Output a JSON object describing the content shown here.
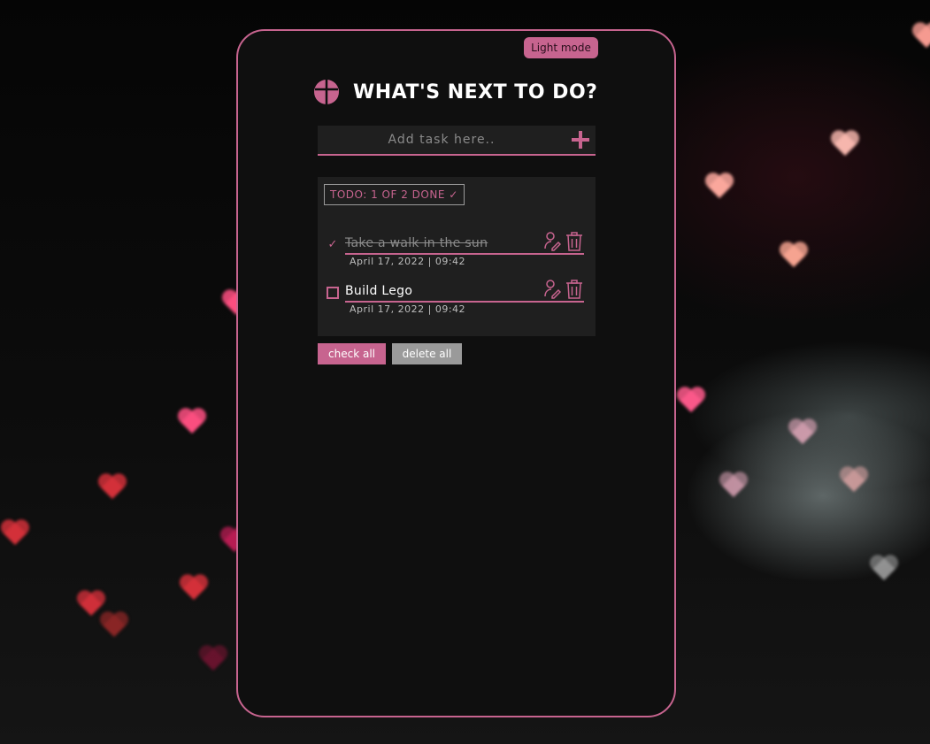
{
  "theme": {
    "accent": "#c7648f",
    "card_background": "#0f0f0f",
    "panel_background": "#1f1f1f",
    "muted_button": "#9a9a9a"
  },
  "header": {
    "mode_toggle_label": "Light mode",
    "title": "WHAT'S NEXT TO DO?"
  },
  "add_task": {
    "placeholder": "Add task here..",
    "value": "",
    "add_icon": "plus-icon"
  },
  "list": {
    "counter_label": "TODO: 1 OF 2 DONE ✓",
    "tasks": [
      {
        "text": "Take a walk in the sun",
        "date": "April 17, 2022 | 09:42",
        "done": true,
        "check_symbol": "✓"
      },
      {
        "text": "Build Lego",
        "date": "April 17, 2022 | 09:42",
        "done": false,
        "check_symbol": ""
      }
    ],
    "edit_icon": "user-edit-icon",
    "delete_icon": "trash-icon"
  },
  "actions": {
    "check_all_label": "check all",
    "delete_all_label": "delete all"
  }
}
